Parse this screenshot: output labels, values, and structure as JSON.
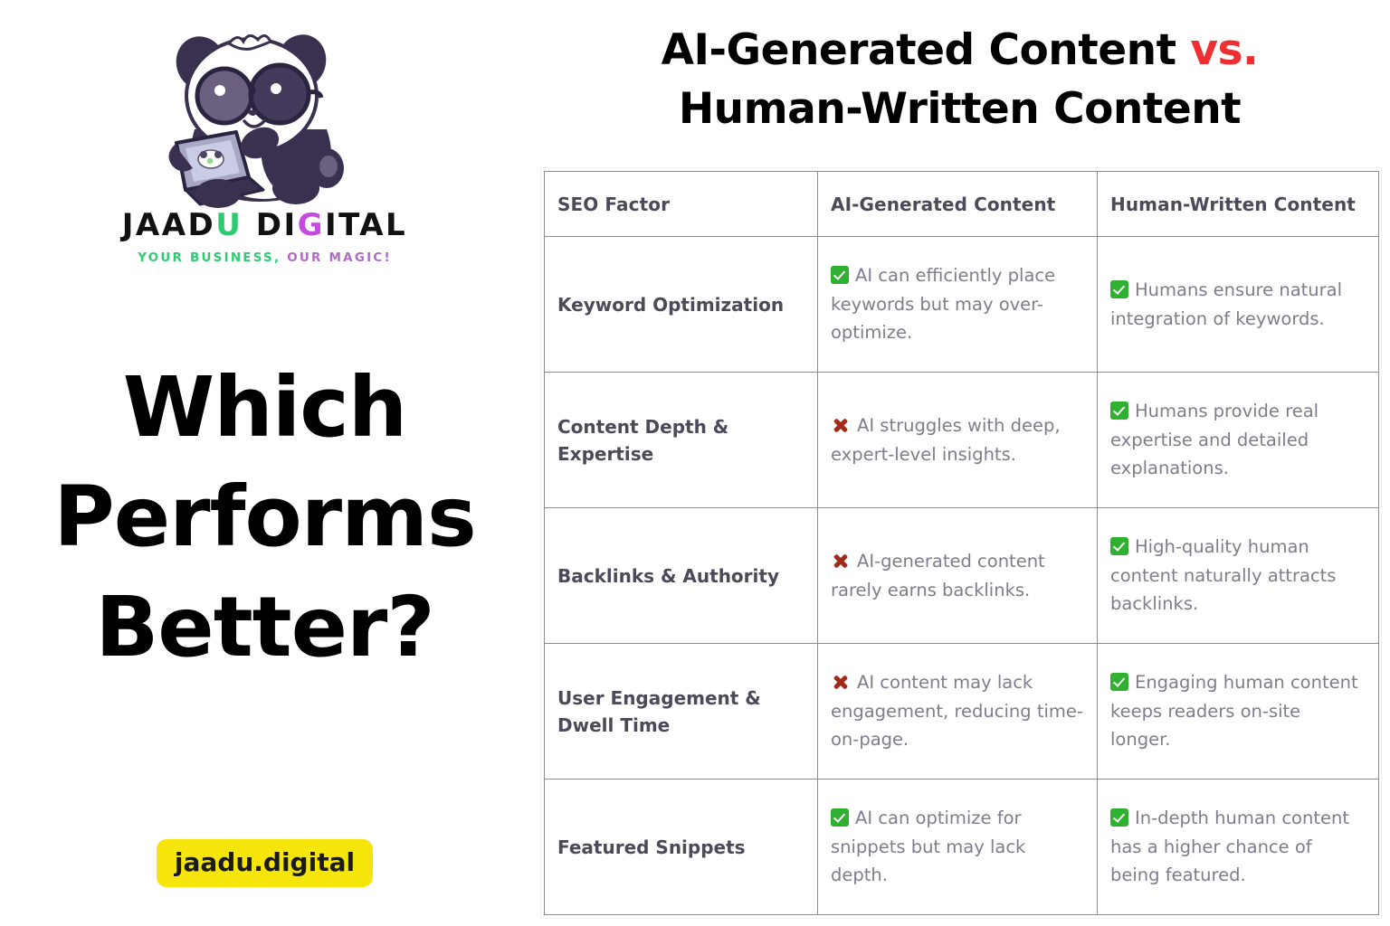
{
  "brand": {
    "logo_icon": "panda-with-laptop-logo",
    "wordmark_part1": "JAAD",
    "wordmark_accent1": "U",
    "wordmark_part2": " DI",
    "wordmark_accent2": "G",
    "wordmark_part3": "ITAL",
    "tagline_green": "YOUR BUSINESS,",
    "tagline_purple": " OUR MAGIC!",
    "accent_green": "#2ECC71",
    "accent_purple": "#C54BE0"
  },
  "headline": {
    "line1": "Which",
    "line2": "Performs",
    "line3": "Better?"
  },
  "site_badge": {
    "label": "jaadu.digital",
    "background": "#F5E50B"
  },
  "title": {
    "line1_main": "AI-Generated Content ",
    "line1_vs": "vs.",
    "line2": "Human-Written Content",
    "vs_color": "#F03030"
  },
  "table": {
    "headers": [
      "SEO Factor",
      "AI-Generated Content",
      "Human-Written Content"
    ],
    "rows": [
      {
        "factor": "Keyword Optimization",
        "ai": {
          "icon": "check-icon",
          "verdict": "positive",
          "text": "AI can efficiently place keywords but may over-optimize."
        },
        "human": {
          "icon": "check-icon",
          "verdict": "positive",
          "text": "Humans ensure natural integration of keywords."
        }
      },
      {
        "factor": "Content Depth & Expertise",
        "ai": {
          "icon": "cross-icon",
          "verdict": "negative",
          "text": "AI struggles with deep, expert-level insights."
        },
        "human": {
          "icon": "check-icon",
          "verdict": "positive",
          "text": "Humans provide real expertise and detailed explanations."
        }
      },
      {
        "factor": "Backlinks & Authority",
        "ai": {
          "icon": "cross-icon",
          "verdict": "negative",
          "text": "AI-generated content rarely earns backlinks."
        },
        "human": {
          "icon": "check-icon",
          "verdict": "positive",
          "text": "High-quality human content naturally attracts backlinks."
        }
      },
      {
        "factor": "User Engagement & Dwell Time",
        "ai": {
          "icon": "cross-icon",
          "verdict": "negative",
          "text": "AI content may lack engagement, reducing time-on-page."
        },
        "human": {
          "icon": "check-icon",
          "verdict": "positive",
          "text": "Engaging human content keeps readers on-site longer."
        }
      },
      {
        "factor": "Featured Snippets",
        "ai": {
          "icon": "check-icon",
          "verdict": "positive",
          "text": "AI can optimize for snippets but may lack depth."
        },
        "human": {
          "icon": "check-icon",
          "verdict": "positive",
          "text": "In-depth human content has a higher chance of being featured."
        }
      }
    ]
  }
}
